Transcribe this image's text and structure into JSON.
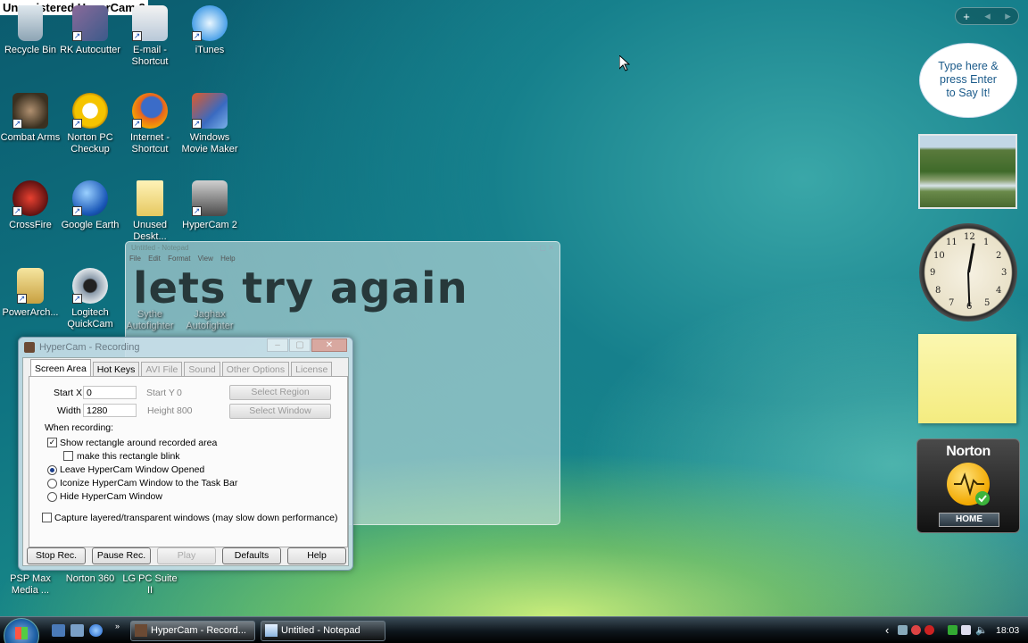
{
  "watermark": "Unregistered HyperCam 2",
  "desktop_icons": [
    {
      "name": "recycle-bin",
      "label": "Recycle Bin"
    },
    {
      "name": "rk-autocutter",
      "label": "RK Autocutter"
    },
    {
      "name": "email-shortcut",
      "label": "E-mail - Shortcut"
    },
    {
      "name": "itunes",
      "label": "iTunes"
    },
    {
      "name": "combat-arms",
      "label": "Combat Arms"
    },
    {
      "name": "norton-pc-checkup",
      "label": "Norton PC Checkup"
    },
    {
      "name": "internet-shortcut",
      "label": "Internet - Shortcut"
    },
    {
      "name": "windows-movie-maker",
      "label": "Windows Movie Maker"
    },
    {
      "name": "crossfire",
      "label": "CrossFire"
    },
    {
      "name": "google-earth",
      "label": "Google Earth"
    },
    {
      "name": "unused-desktop",
      "label": "Unused Deskt..."
    },
    {
      "name": "hypercam-2",
      "label": "HyperCam 2"
    },
    {
      "name": "powerarchiver",
      "label": "PowerArch..."
    },
    {
      "name": "logitech-quickcam",
      "label": "Logitech QuickCam"
    },
    {
      "name": "sythe-autofighter",
      "label": "Sythe Autofighter"
    },
    {
      "name": "jaghax-autofighter",
      "label": "Jaghax Autofighter"
    },
    {
      "name": "psp-max-media",
      "label": "PSP Max Media ..."
    },
    {
      "name": "norton-360",
      "label": "Norton 360"
    },
    {
      "name": "lg-pc-suite",
      "label": "LG PC Suite II"
    }
  ],
  "notepad": {
    "title": "Untitled - Notepad",
    "menu": "File Edit Format View Help",
    "text": "lets try again"
  },
  "hypercam": {
    "title": "HyperCam - Recording",
    "tabs": [
      "Screen Area",
      "Hot Keys",
      "AVI File",
      "Sound",
      "Other Options",
      "License"
    ],
    "start_x_label": "Start X",
    "start_x_value": "0",
    "start_y_label": "Start Y",
    "start_y_value": "0",
    "width_label": "Width",
    "width_value": "1280",
    "height_label": "Height",
    "height_value": "800",
    "select_region": "Select Region",
    "select_window": "Select Window",
    "when_recording": "When recording:",
    "show_rect": "Show rectangle around recorded area",
    "make_blink": "make this rectangle blink",
    "leave_opened": "Leave HyperCam Window Opened",
    "iconize": "Iconize HyperCam Window to the Task Bar",
    "hide": "Hide HyperCam Window",
    "capture_layered": "Capture layered/transparent windows (may slow down performance)",
    "buttons": {
      "stop": "Stop Rec.",
      "pause": "Pause Rec.",
      "play": "Play",
      "defaults": "Defaults",
      "help": "Help"
    }
  },
  "gadgets": {
    "toolbar_add": "+",
    "toolbar_prev": "◂",
    "toolbar_next": "▸",
    "speech_text": "Type here & press Enter to Say It!",
    "norton_logo": "Norton",
    "norton_home": "HOME"
  },
  "taskbar": {
    "buttons": [
      "HyperCam - Record...",
      "Untitled - Notepad"
    ],
    "time": "18:03",
    "tray_chevron": "‹"
  }
}
